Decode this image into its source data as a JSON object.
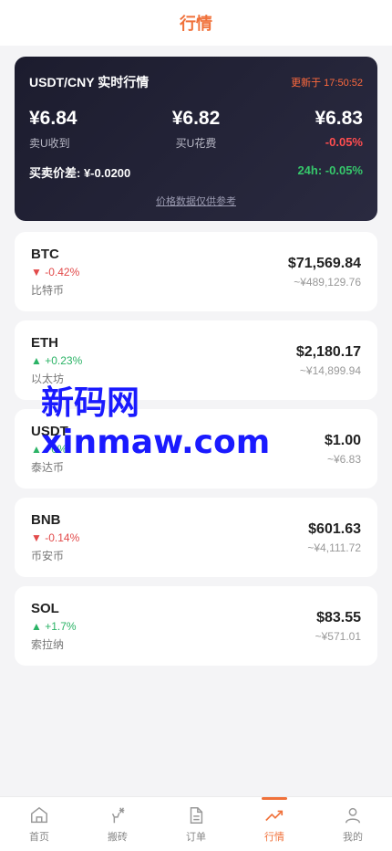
{
  "header": {
    "title": "行情"
  },
  "hero": {
    "title": "USDT/CNY 实时行情",
    "updated": "更新于 17:50:52",
    "rates": [
      {
        "value": "¥6.84",
        "label": "卖U收到"
      },
      {
        "value": "¥6.82",
        "label": "买U花费"
      },
      {
        "value": "¥6.83",
        "label": "-0.05%"
      }
    ],
    "spread": "买卖价差: ¥-0.0200",
    "change24h": "24h: -0.05%",
    "note": "价格数据仅供参考"
  },
  "coins": [
    {
      "symbol": "BTC",
      "change": "▼ -0.42%",
      "dir": "down",
      "name": "比特币",
      "price": "$71,569.84",
      "cny": "~¥489,129.76"
    },
    {
      "symbol": "ETH",
      "change": "▲ +0.23%",
      "dir": "up",
      "name": "以太坊",
      "price": "$2,180.17",
      "cny": "~¥14,899.94"
    },
    {
      "symbol": "USDT",
      "change": "▲ +0%",
      "dir": "up",
      "name": "泰达币",
      "price": "$1.00",
      "cny": "~¥6.83"
    },
    {
      "symbol": "BNB",
      "change": "▼ -0.14%",
      "dir": "down",
      "name": "币安币",
      "price": "$601.63",
      "cny": "~¥4,111.72"
    },
    {
      "symbol": "SOL",
      "change": "▲ +1.7%",
      "dir": "up",
      "name": "索拉纳",
      "price": "$83.55",
      "cny": "~¥571.01"
    }
  ],
  "watermark": "新码网xinmaw.com",
  "tabs": [
    {
      "label": "首页",
      "icon": "home-icon"
    },
    {
      "label": "搬砖",
      "icon": "bitcoin-hand-icon"
    },
    {
      "label": "订单",
      "icon": "document-icon"
    },
    {
      "label": "行情",
      "icon": "trend-icon",
      "active": true
    },
    {
      "label": "我的",
      "icon": "user-icon"
    }
  ],
  "colors": {
    "accent": "#f0713a",
    "up": "#2bb366",
    "down": "#e24a4a"
  }
}
